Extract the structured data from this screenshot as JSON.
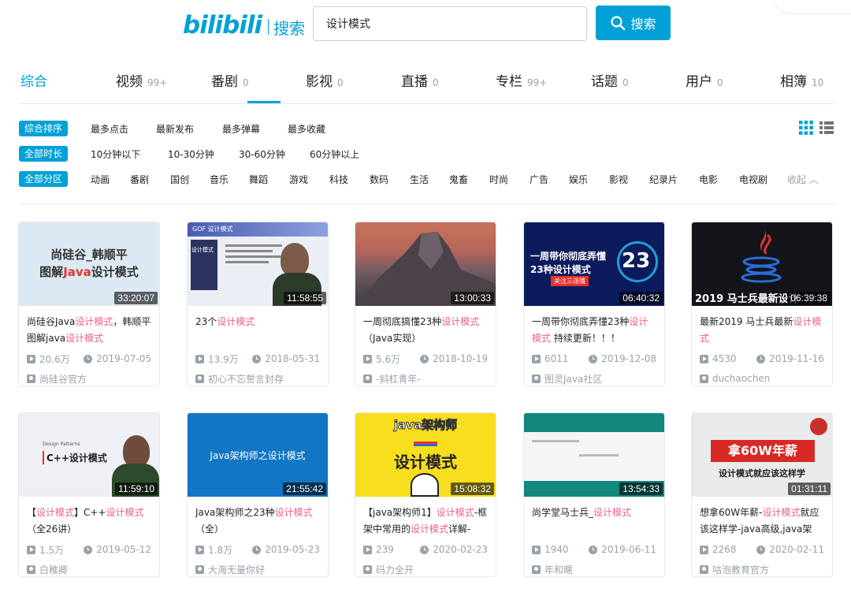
{
  "header": {
    "logo": "bilibili",
    "logo_suffix": "搜索",
    "search_value": "设计模式",
    "search_button": "搜索"
  },
  "tabs": [
    {
      "label": "综合",
      "count": ""
    },
    {
      "label": "视频",
      "count": "99+"
    },
    {
      "label": "番剧",
      "count": "0"
    },
    {
      "label": "影视",
      "count": "0"
    },
    {
      "label": "直播",
      "count": "0"
    },
    {
      "label": "专栏",
      "count": "99+"
    },
    {
      "label": "话题",
      "count": "0"
    },
    {
      "label": "用户",
      "count": "0"
    },
    {
      "label": "相簿",
      "count": "10"
    }
  ],
  "filters": {
    "order": {
      "chip": "综合排序",
      "items": [
        "最多点击",
        "最新发布",
        "最多弹幕",
        "最多收藏"
      ]
    },
    "duration": {
      "chip": "全部时长",
      "items": [
        "10分钟以下",
        "10-30分钟",
        "30-60分钟",
        "60分钟以上"
      ]
    },
    "zone": {
      "chip": "全部分区",
      "items": [
        "动画",
        "番剧",
        "国创",
        "音乐",
        "舞蹈",
        "游戏",
        "科技",
        "数码",
        "生活",
        "鬼畜",
        "时尚",
        "广告",
        "娱乐",
        "影视",
        "纪录片",
        "电影",
        "电视剧"
      ],
      "collapse": "收起"
    }
  },
  "videos": [
    {
      "duration": "33:20:07",
      "title_a": "尚硅谷Java",
      "title_hl": "设计模式",
      "title_b": "，韩顺平图解java",
      "title_hl2": "设计模式",
      "title_c": "",
      "views": "20.6万",
      "date": "2019-07-05",
      "uploader": "尚硅谷官方",
      "thumb_text": [
        "尚硅谷_韩顺平",
        "图解",
        "Java",
        "设计模式"
      ]
    },
    {
      "duration": "11:58:55",
      "title_a": "23个",
      "title_hl": "设计模式",
      "title_b": "",
      "title_hl2": "",
      "title_c": "",
      "views": "13.9万",
      "date": "2018-05-31",
      "uploader": "初心不忘誓言封存",
      "thumb_text": [
        "GOF 设计模式",
        "设计模式"
      ]
    },
    {
      "duration": "13:00:33",
      "title_a": "一周彻底搞懂23种",
      "title_hl": "设计模式",
      "title_b": "（Java实现）",
      "title_hl2": "",
      "title_c": "",
      "views": "5.6万",
      "date": "2018-10-19",
      "uploader": "-斜杠青年-",
      "thumb_text": []
    },
    {
      "duration": "06:40:32",
      "title_a": "一周带你彻底弄懂23种",
      "title_hl": "设计模式",
      "title_b": " 持续更新！！！",
      "title_hl2": "",
      "title_c": "",
      "views": "6011",
      "date": "2019-12-08",
      "uploader": "图灵Java社区",
      "thumb_text": [
        "一周带你彻底弄懂",
        "23种设计模式",
        "23",
        "关注三连哦"
      ]
    },
    {
      "duration": "06:39:38",
      "title_a": "最新2019 马士兵最新",
      "title_hl": "设计模式",
      "title_b": "",
      "title_hl2": "",
      "title_c": "",
      "views": "4530",
      "date": "2019-11-16",
      "uploader": "duchaochen",
      "thumb_text": [
        "2019  马士兵最新设计"
      ]
    },
    {
      "duration": "11:59:10",
      "title_a": "【",
      "title_hl": "设计模式",
      "title_b": "】C++",
      "title_hl2": "设计模式",
      "title_c": "（全26讲）",
      "views": "1.5万",
      "date": "2019-05-12",
      "uploader": "白稚卿",
      "thumb_text": [
        "Design Patterns",
        "C++设计模式"
      ]
    },
    {
      "duration": "21:55:42",
      "title_a": "Java架构师之23种",
      "title_hl": "设计模式",
      "title_b": "（全）",
      "title_hl2": "",
      "title_c": "",
      "views": "1.8万",
      "date": "2019-05-23",
      "uploader": "大海无量你好",
      "thumb_text": [
        "Java架构师之设计模式"
      ]
    },
    {
      "duration": "15:08:32",
      "title_a": "【java架构师1】",
      "title_hl": "设计模式",
      "title_b": "-框架中常用的",
      "title_hl2": "设计模式",
      "title_c": "详解-",
      "views": "239",
      "date": "2020-02-23",
      "uploader": "码力全开",
      "thumb_text": [
        "java架构师",
        "设计模式"
      ]
    },
    {
      "duration": "13:54:33",
      "title_a": "尚学堂马士兵_",
      "title_hl": "设计模式",
      "title_b": "",
      "title_hl2": "",
      "title_c": "",
      "views": "1940",
      "date": "2019-06-11",
      "uploader": "年和暱",
      "thumb_text": []
    },
    {
      "duration": "01:31:11",
      "title_a": "想拿60W年薪-",
      "title_hl": "设计模式",
      "title_b": "就应该这样学-java高级,java架",
      "title_hl2": "",
      "title_c": "",
      "views": "2268",
      "date": "2020-02-11",
      "uploader": "咕泡教育官方",
      "thumb_text": [
        "拿60W年薪",
        "设计模式就应该这样学"
      ]
    }
  ],
  "colors": {
    "accent": "#00a1d6",
    "highlight": "#f25d8e",
    "muted": "#99a2aa"
  }
}
